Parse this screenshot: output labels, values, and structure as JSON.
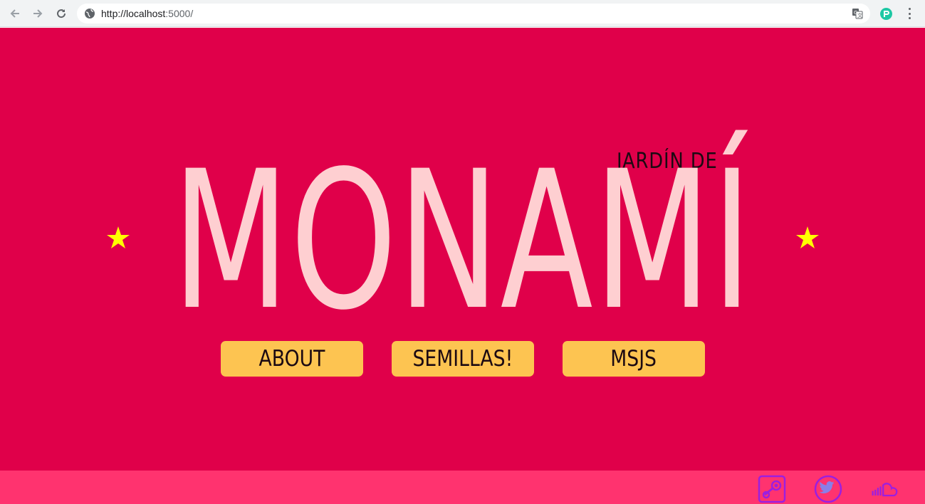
{
  "browser": {
    "url_host": "http://localhost",
    "url_path": ":5000/",
    "icons": [
      "back-arrow-icon",
      "forward-arrow-icon",
      "reload-icon",
      "globe-icon",
      "translate-icon",
      "extension-icon",
      "menu-dots-icon"
    ]
  },
  "hero": {
    "subtitle": "JARDÍN DE",
    "title": "MONAMÍ",
    "decorations": [
      "star-icon",
      "star-icon"
    ]
  },
  "nav": {
    "buttons": [
      {
        "label": "ABOUT"
      },
      {
        "label": "SEMILLAS!"
      },
      {
        "label": "MSJS"
      }
    ]
  },
  "footer": {
    "social": [
      "steam-icon",
      "twitter-icon",
      "soundcloud-icon"
    ]
  },
  "colors": {
    "background": "#e0004a",
    "title": "#fecfd1",
    "button": "#fdc451",
    "footer": "#ff336f",
    "star": "#ffff00",
    "social_icon": "#9b1fe0"
  }
}
